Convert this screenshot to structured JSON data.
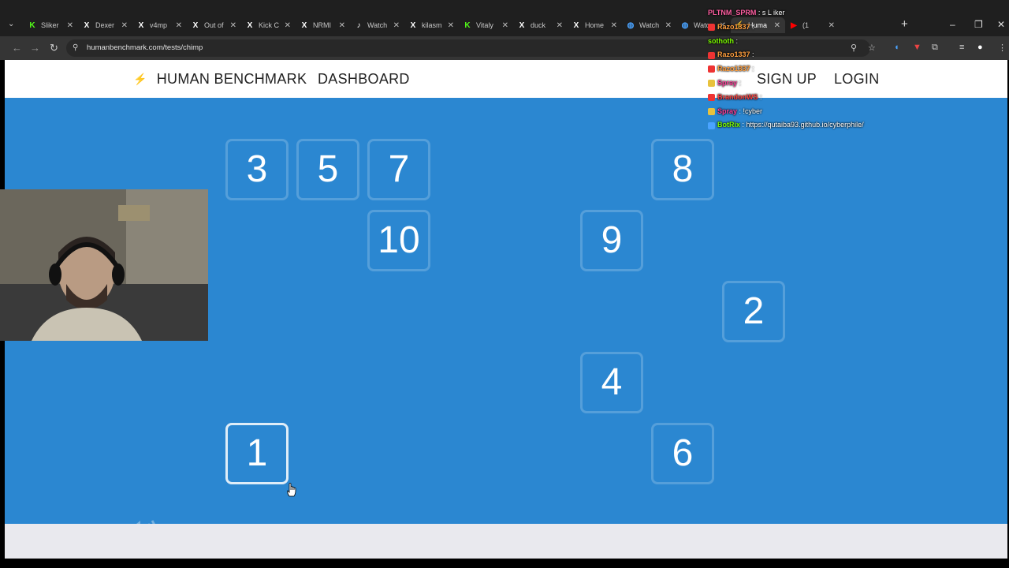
{
  "browser": {
    "tabs": [
      {
        "title": "Sliker",
        "icon": "kick-logo-icon",
        "color": "#53fc18",
        "active": false
      },
      {
        "title": "Dexer",
        "icon": "x-logo-icon",
        "color": "#ffffff",
        "active": false
      },
      {
        "title": "v4mp",
        "icon": "x-logo-icon",
        "color": "#ffffff",
        "active": false
      },
      {
        "title": "Out of",
        "icon": "x-logo-icon",
        "color": "#ffffff",
        "active": false
      },
      {
        "title": "Kick C",
        "icon": "x-logo-icon",
        "color": "#ffffff",
        "active": false
      },
      {
        "title": "NRMI",
        "icon": "x-logo-icon",
        "color": "#ffffff",
        "active": false
      },
      {
        "title": "Watch",
        "icon": "tiktok-logo-icon",
        "color": "#ffffff",
        "active": false
      },
      {
        "title": "kilasm",
        "icon": "x-logo-icon",
        "color": "#ffffff",
        "active": false
      },
      {
        "title": "Vitaly",
        "icon": "kick-logo-icon",
        "color": "#53fc18",
        "active": false
      },
      {
        "title": "duck",
        "icon": "x-logo-icon",
        "color": "#ffffff",
        "active": false
      },
      {
        "title": "Home",
        "icon": "x-logo-icon",
        "color": "#ffffff",
        "active": false
      },
      {
        "title": "Watch",
        "icon": "globe-icon",
        "color": "#4aa3ff",
        "active": false
      },
      {
        "title": "Watc",
        "icon": "globe-icon",
        "color": "#4aa3ff",
        "active": false
      },
      {
        "title": "Huma",
        "icon": "bolt-icon",
        "color": "#f5a623",
        "active": true
      },
      {
        "title": "(1",
        "icon": "youtube-logo-icon",
        "color": "#ff0000",
        "active": false
      }
    ],
    "url": "humanbenchmark.com/tests/chimp"
  },
  "site": {
    "logo_text": "HUMAN BENCHMARK",
    "nav": {
      "dashboard": "DASHBOARD",
      "signup": "SIGN UP",
      "login": "LOGIN"
    },
    "accent": "#2b87d1"
  },
  "game": {
    "cells": [
      {
        "num": "3",
        "col": 0,
        "row": 0
      },
      {
        "num": "5",
        "col": 1,
        "row": 0
      },
      {
        "num": "7",
        "col": 2,
        "row": 0
      },
      {
        "num": "8",
        "col": 6,
        "row": 0
      },
      {
        "num": "10",
        "col": 2,
        "row": 1
      },
      {
        "num": "9",
        "col": 5,
        "row": 1
      },
      {
        "num": "2",
        "col": 7,
        "row": 2
      },
      {
        "num": "4",
        "col": 5,
        "row": 3
      },
      {
        "num": "1",
        "col": 0,
        "row": 4,
        "highlight": true
      },
      {
        "num": "6",
        "col": 6,
        "row": 4
      }
    ],
    "sound_icon": "speaker-icon"
  },
  "chat": [
    {
      "user": "PLTNM_SPRM",
      "color": "#ff5fa2",
      "msg": "s L iker",
      "badge": ""
    },
    {
      "user": "Razo1337",
      "color": "#ff9e3d",
      "msg": "",
      "badge": "#e33"
    },
    {
      "user": "sothoth",
      "color": "#7cfc00",
      "msg": "",
      "badge": ""
    },
    {
      "user": "Razo1337",
      "color": "#ff9e3d",
      "msg": "",
      "badge": "#e33"
    },
    {
      "user": "Razo1337",
      "color": "#ff9e3d",
      "msg": "",
      "badge": "#e33"
    },
    {
      "user": "Spray",
      "color": "#ff3d9a",
      "msg": "",
      "badge": "#e8c23d"
    },
    {
      "user": "BrandonWS",
      "color": "#ff3d3d",
      "msg": "",
      "badge": "#e33"
    },
    {
      "user": "Spray",
      "color": "#ff3d9a",
      "msg": "!cyber",
      "badge": "#e8c23d"
    },
    {
      "user": "BotRix",
      "color": "#7cfc00",
      "msg": "https://qutaiba93.github.io/cyberphile/",
      "badge": "#4aa3ff"
    }
  ]
}
